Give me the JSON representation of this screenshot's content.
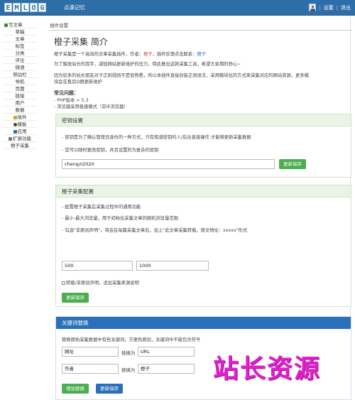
{
  "header": {
    "logo_letters": [
      "E",
      "M",
      "L",
      "O",
      "G"
    ],
    "site_name": "点滴记忆",
    "menu": [
      "设置",
      "退出"
    ],
    "sep": "|"
  },
  "sidebar": {
    "items": [
      {
        "label": "写文章",
        "icon": "pencil-icon"
      },
      {
        "label": "草稿"
      },
      {
        "label": "文章"
      },
      {
        "label": "标签"
      },
      {
        "label": "分类"
      },
      {
        "label": "评论"
      },
      {
        "label": "微语"
      },
      {
        "label": "侧边栏"
      },
      {
        "label": "导航"
      },
      {
        "label": "页面"
      },
      {
        "label": "链接"
      },
      {
        "label": "用户"
      },
      {
        "label": "数据"
      },
      {
        "label": "插件",
        "icon": "plugin-icon"
      },
      {
        "label": "模板",
        "icon": "template-icon"
      },
      {
        "label": "应用",
        "icon": "app-icon"
      },
      {
        "label": "扩展功能",
        "icon": "extend-icon"
      },
      {
        "label": "橙子采集"
      }
    ]
  },
  "main": {
    "breadcrumb": "插件设置",
    "title": "橙子采集 简介",
    "intro": {
      "line1_a": "橙子采集是一个高效的文章采集插件，作者：",
      "line1_author": "橙子",
      "line1_b": "，插件反馈点击联系：",
      "line1_link": "橙子",
      "line2": "为了解放站长的双手，减轻网站更新维护的压力，特此推出这款采集工具，希望大家用的舒心~",
      "line3": "因为较多的站长朋友对于正则规则不是很熟悉，所以本插件直接封装正则语法，采用模块化的方式来采集对应的网站资源，更多模",
      "line4": "块会在售后Q群更新维护"
    },
    "faq": {
      "title": "常见问题：",
      "items": [
        "- PHP版本 > 5.3",
        "- 浏览器采用极速模式（非IE浏览器）"
      ]
    }
  },
  "secret_panel": {
    "title": "密钥设置",
    "lines": [
      "- 密钥是为了确认管理员身份的一种方式，只有知道密钥的人/后台直接操作 才能够更新采集数据",
      "- 您可以随时更改密钥，并且设置的为复杂的密钥"
    ],
    "value": "chengzi2020",
    "save_label": "更新保存"
  },
  "config_panel": {
    "title": "橙子采集配置",
    "lines": [
      "- 配置橙子采集在采集过程中的通用功能",
      "- 最小-最大浏览量，用于初始化采集文章的随机浏览量范围",
      "- 勾选\"非原创声明\"，将会在每篇采集文章后，加上\"此文章采集转载，原文地址：xxxxx\"形式"
    ],
    "min_views": "500",
    "max_views": "1000",
    "checkbox_label": "转载/非原创声明，追加采集来源说明",
    "save_label": "更新保存"
  },
  "keyword_panel": {
    "title": "关键词替换",
    "desc": "替换原始采集数据中有些关键词，方便伪原创，关键词中不能包含符号",
    "rows": [
      {
        "from": "网址",
        "replace_label": "替换为",
        "to": "URL"
      },
      {
        "from": "作者",
        "replace_label": "替换为",
        "to": "橙子"
      }
    ],
    "add_label": "增加替换",
    "save_label": "更新保存"
  },
  "watermark": "站长资源"
}
